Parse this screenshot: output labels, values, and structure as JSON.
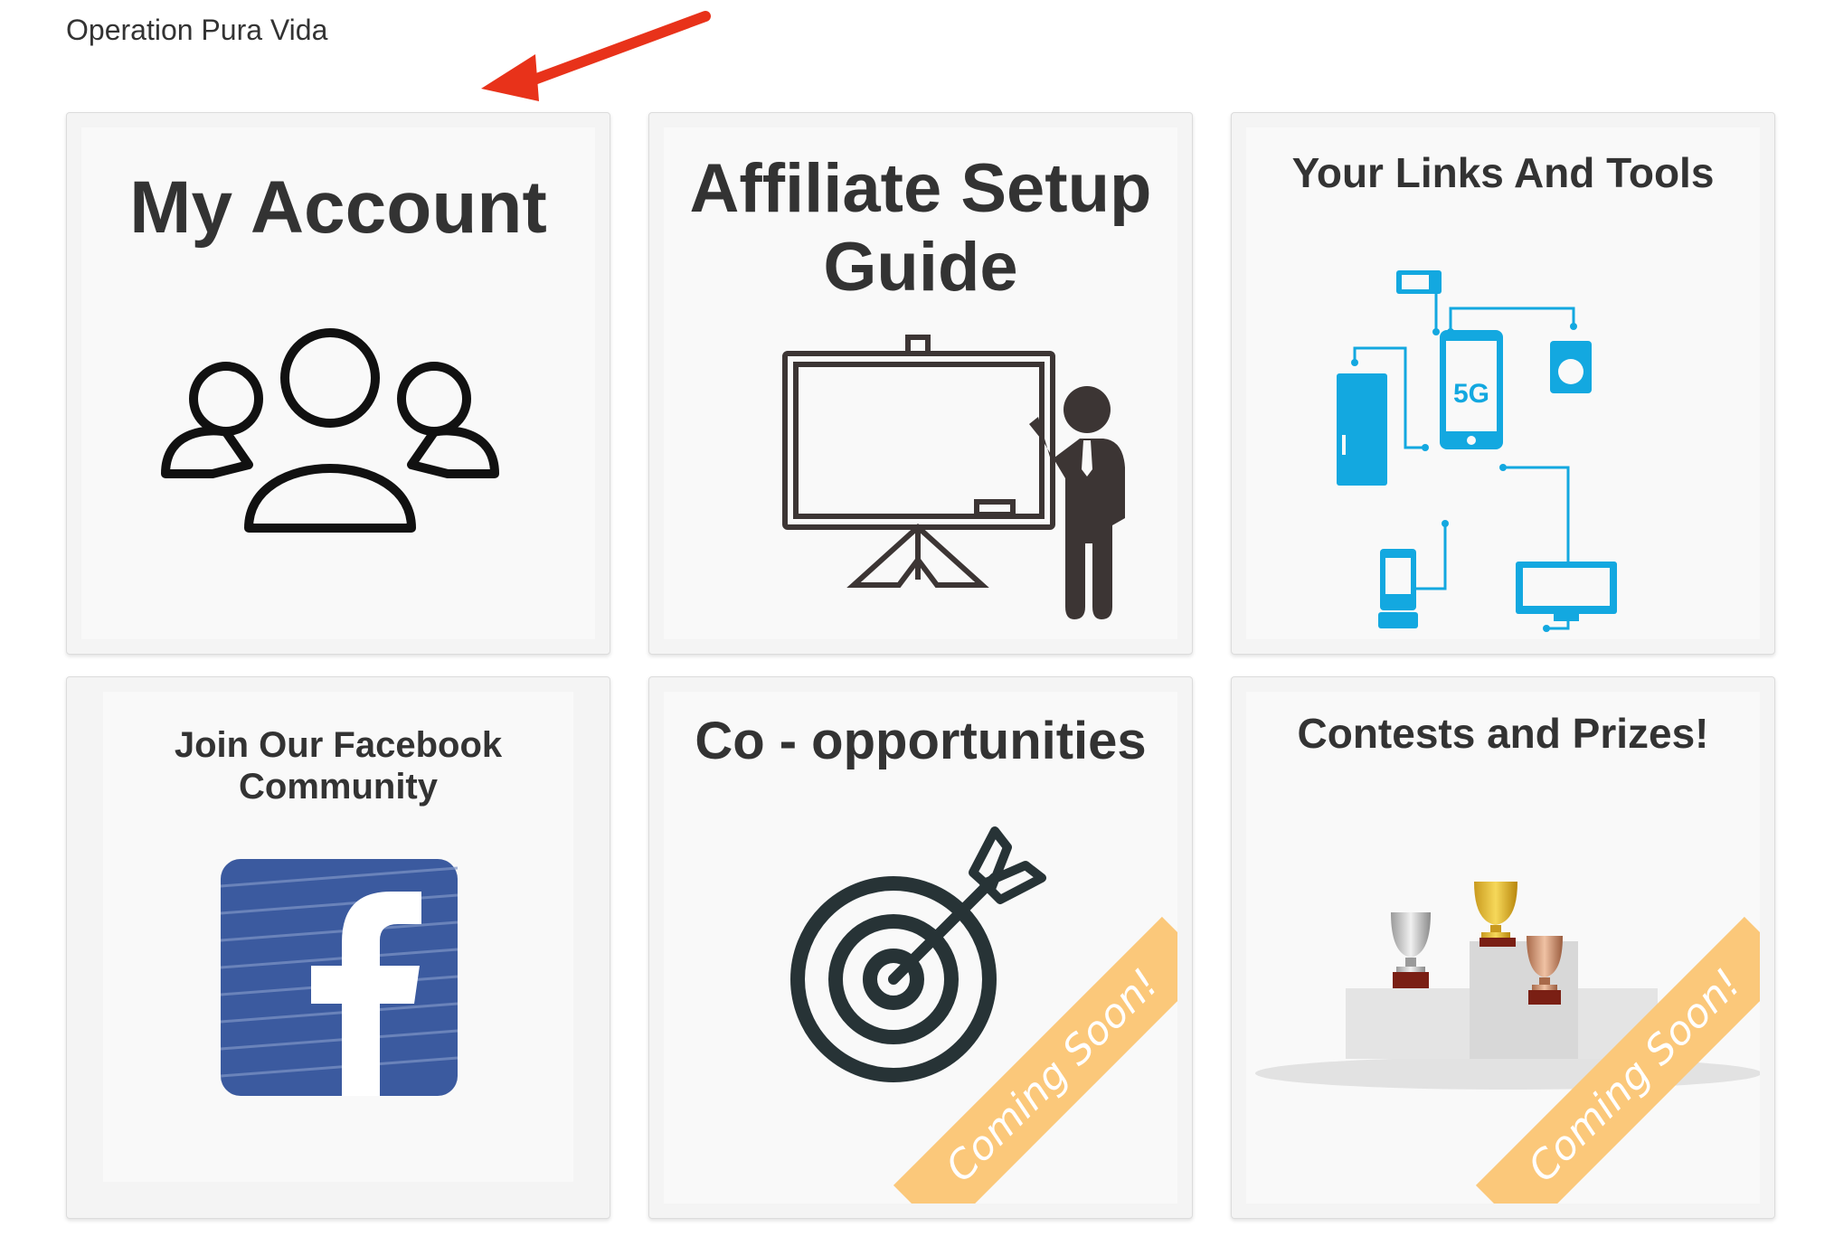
{
  "header": {
    "site_title": "Operation Pura Vida"
  },
  "cards": [
    {
      "title": "My Account",
      "icon": "users-group-icon"
    },
    {
      "title": "Affiliate Setup Guide",
      "icon": "presentation-board-icon"
    },
    {
      "title": "Your Links And Tools",
      "icon": "network-devices-icon"
    },
    {
      "title": "Join Our Facebook Community",
      "icon": "facebook-icon"
    },
    {
      "title": "Co - opportunities",
      "icon": "target-arrow-icon",
      "badge": "Coming Soon!"
    },
    {
      "title": "Contests and Prizes!",
      "icon": "trophies-podium-icon",
      "badge": "Coming Soon!"
    }
  ],
  "colors": {
    "arrow": "#e8321a",
    "tech_blue": "#13a8e0",
    "ribbon": "#fbc87a",
    "facebook": "#3b5a9f",
    "icon_dark": "#3c3534"
  }
}
